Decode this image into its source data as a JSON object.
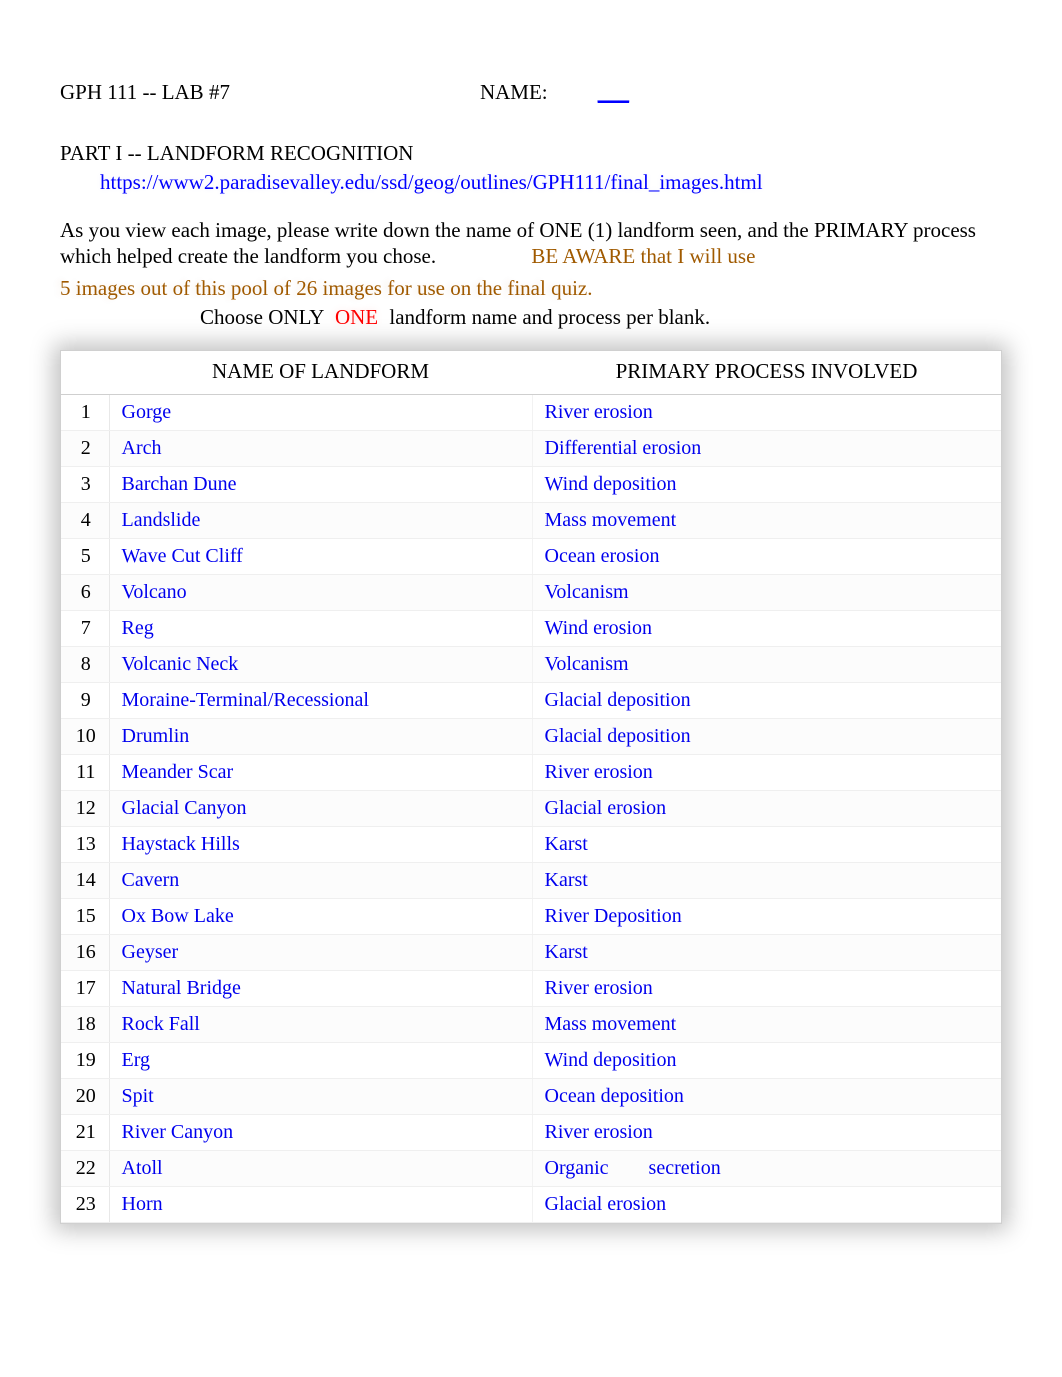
{
  "header": {
    "course_lab": "GPH 111 -- LAB #7",
    "name_label": "NAME:",
    "name_blank": "___"
  },
  "part1": {
    "title": "PART I   --  LANDFORM RECOGNITION",
    "url": "https://www2.paradisevalley.edu/ssd/geog/outlines/GPH111/final_images.html",
    "instr_line1": "As you view each image, please write down the name of ONE (1) landform seen, and the PRIMARY process which helped create the landform you chose.",
    "warn_part1": "BE AWARE that I will use",
    "warn_line2": "5 images out of this pool of 26 images for use on the final quiz.",
    "choose_prefix": "Choose ONLY",
    "choose_one": " ONE ",
    "choose_suffix": "landform name and process per blank."
  },
  "table": {
    "headers": {
      "num": "",
      "name": "NAME OF LANDFORM",
      "process": "PRIMARY PROCESS INVOLVED"
    },
    "rows": [
      {
        "n": "1",
        "name": "Gorge",
        "proc": "River erosion"
      },
      {
        "n": "2",
        "name": "Arch",
        "proc": "Differential erosion"
      },
      {
        "n": "3",
        "name": "Barchan Dune",
        "proc": "Wind deposition"
      },
      {
        "n": "4",
        "name": "Landslide",
        "proc": "Mass movement"
      },
      {
        "n": "5",
        "name": "Wave Cut Cliff",
        "proc": "Ocean erosion"
      },
      {
        "n": "6",
        "name": "Volcano",
        "proc": "Volcanism"
      },
      {
        "n": "7",
        "name": "Reg",
        "proc": "Wind erosion"
      },
      {
        "n": "8",
        "name": "Volcanic Neck",
        "proc": "Volcanism"
      },
      {
        "n": "9",
        "name": "Moraine-Terminal/Recessional",
        "proc": "Glacial deposition"
      },
      {
        "n": "10",
        "name": "Drumlin",
        "proc": "Glacial deposition"
      },
      {
        "n": "11",
        "name": "Meander Scar",
        "proc": "River erosion"
      },
      {
        "n": "12",
        "name": "Glacial Canyon",
        "proc": "Glacial erosion"
      },
      {
        "n": "13",
        "name": "Haystack Hills",
        "proc": "Karst"
      },
      {
        "n": "14",
        "name": "Cavern",
        "proc": "Karst"
      },
      {
        "n": "15",
        "name": "Ox Bow Lake",
        "proc": "River Deposition"
      },
      {
        "n": "16",
        "name": "Geyser",
        "proc": "Karst"
      },
      {
        "n": "17",
        "name": "Natural Bridge",
        "proc": "River erosion"
      },
      {
        "n": "18",
        "name": "Rock Fall",
        "proc": "Mass movement"
      },
      {
        "n": "19",
        "name": "Erg",
        "proc": "Wind deposition"
      },
      {
        "n": "20",
        "name": "Spit",
        "proc": "Ocean deposition"
      },
      {
        "n": "21",
        "name": "River Canyon",
        "proc": "River erosion"
      },
      {
        "n": "22",
        "name": "Atoll",
        "proc": "Organic  secretion"
      },
      {
        "n": "23",
        "name": "Horn",
        "proc": "Glacial erosion"
      }
    ]
  }
}
